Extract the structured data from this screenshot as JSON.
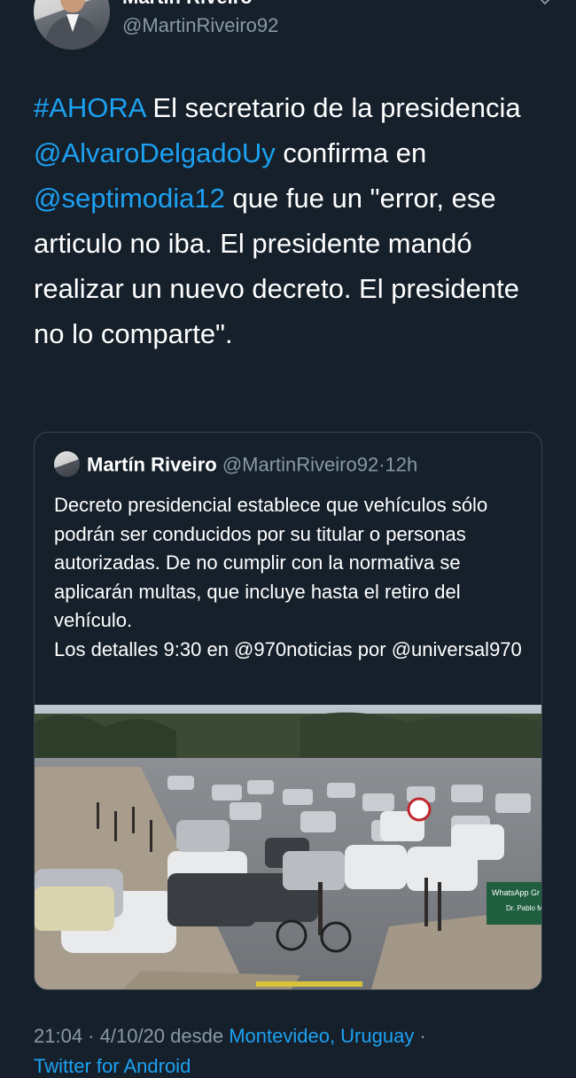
{
  "author": {
    "display_name": "Martín Riveiro",
    "handle": "@MartinRiveiro92"
  },
  "tweet": {
    "hashtag": "#AHORA",
    "text_1": " El secretario de la presidencia ",
    "mention_1": "@AlvaroDelgadoUy",
    "text_2": " confirma en ",
    "mention_2": "@septimodia12",
    "text_3": " que fue un \"error, ese articulo no iba. El presidente mandó realizar un nuevo decreto. El presidente no lo comparte\"."
  },
  "quoted_tweet": {
    "display_name": "Martín Riveiro",
    "handle": "@MartinRiveiro92",
    "separator": "·",
    "time": "12h",
    "text": "Decreto presidencial establece que vehículos sólo podrán ser conducidos por su titular o personas autorizadas. De no cumplir con la normativa se aplicarán multas, que incluye hasta el retiro del vehículo.\nLos detalles 9:30 en @970noticias por @universal970",
    "image_description": "traffic-street-photo",
    "sign_text": "WhatsApp Gr",
    "sign_text_2": "Dr. Pablo María"
  },
  "footer": {
    "time": "21:04",
    "sep1": " · ",
    "date": "4/10/20",
    "from": " desde ",
    "location": "Montevideo, Uruguay",
    "sep2": " ·",
    "client": "Twitter for Android"
  },
  "colors": {
    "background": "#15202b",
    "link": "#1da1f2",
    "secondary_text": "#8899a6",
    "border": "#38444d"
  },
  "icons": {
    "chevron": "chevron-down-icon"
  }
}
